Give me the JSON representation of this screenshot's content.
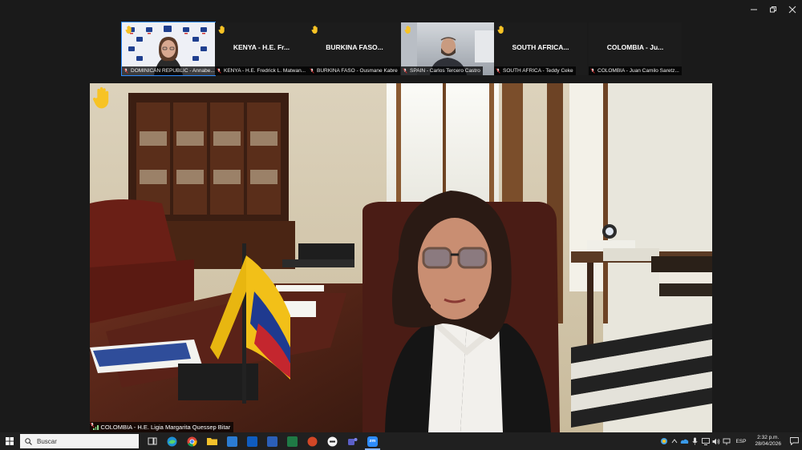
{
  "window": {
    "controls": [
      "minimize",
      "maximize",
      "close"
    ]
  },
  "participants": [
    {
      "name_display": "",
      "label": "DOMINICAN REPUBLIC - Annabe...",
      "hand_raised": true,
      "muted": true,
      "video": "on",
      "active": true
    },
    {
      "name_display": "KENYA - H.E. Fr...",
      "label": "KENYA - H.E. Fredrick L. Matwan...",
      "hand_raised": true,
      "muted": true,
      "video": "off"
    },
    {
      "name_display": "BURKINA FASO...",
      "label": "BURKINA FASO - Ousmane Kabre",
      "hand_raised": true,
      "muted": true,
      "video": "off"
    },
    {
      "name_display": "",
      "label": "SPAIN - Carlos Tercero Castro",
      "hand_raised": true,
      "muted": true,
      "video": "on"
    },
    {
      "name_display": "SOUTH AFRICA...",
      "label": "SOUTH AFRICA - Teddy Ceke",
      "hand_raised": true,
      "muted": true,
      "video": "off"
    },
    {
      "name_display": "COLOMBIA - Ju...",
      "label": "COLOMBIA - Juan Camilo Saretz...",
      "hand_raised": false,
      "muted": true,
      "video": "off"
    }
  ],
  "main_speaker": {
    "label": "COLOMBIA - H.E. Ligia Margarita Quessep Bitar",
    "hand_raised": true,
    "muted": true
  },
  "taskbar": {
    "search_placeholder": "Buscar",
    "apps": [
      "task-view",
      "edge",
      "chrome",
      "file-explorer",
      "outlook-new",
      "outlook",
      "word",
      "excel",
      "powerpoint",
      "app-circle",
      "teams",
      "zoom"
    ],
    "language": "ESP",
    "time": "2:32 p.m.",
    "date": "28/04/2026"
  },
  "colors": {
    "zoom_blue": "#2d8cff",
    "hand_yellow": "#f7c325",
    "muted_red": "#e02828",
    "taskbar": "#202020"
  }
}
